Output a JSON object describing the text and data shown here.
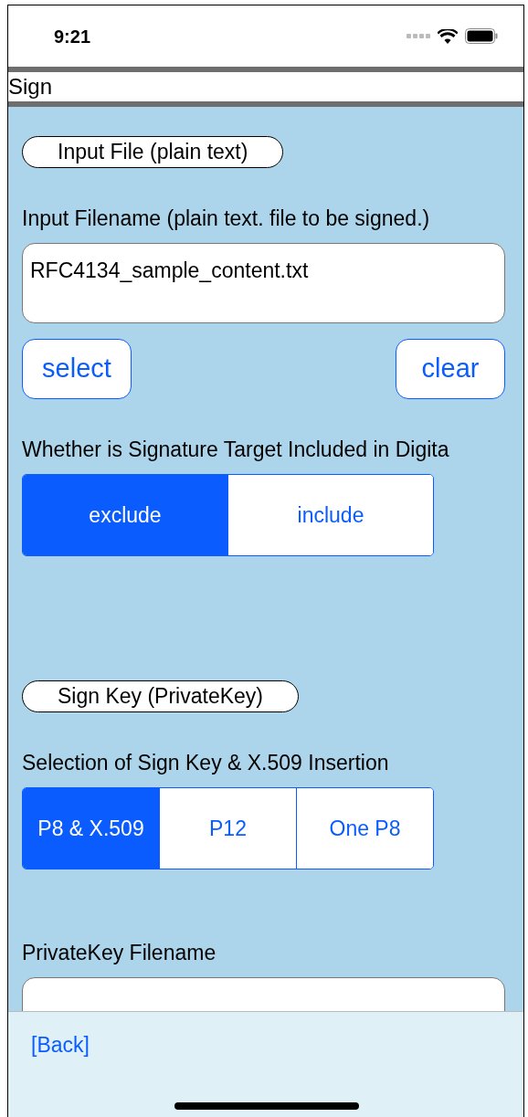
{
  "status_bar": {
    "time": "9:21"
  },
  "nav": {
    "title": "Sign"
  },
  "sections": [
    {
      "kind": "header",
      "label": "Input File (plain text)"
    },
    {
      "kind": "label",
      "text": "Input Filename (plain text. file to be signed.)"
    },
    {
      "kind": "field",
      "value": "RFC4134_sample_content.txt"
    },
    {
      "kind": "buttons",
      "buttons": [
        "select",
        "clear"
      ]
    },
    {
      "kind": "label",
      "text": "Whether is Signature Target Included in Digita"
    },
    {
      "kind": "segmented",
      "segments": [
        {
          "label": "exclude",
          "selected": true
        },
        {
          "label": "include",
          "selected": false
        }
      ]
    },
    {
      "kind": "spacer"
    },
    {
      "kind": "header",
      "label": "Sign Key (PrivateKey)"
    },
    {
      "kind": "label",
      "text": "Selection of Sign Key & X.509 Insertion"
    },
    {
      "kind": "segmented",
      "segments": [
        {
          "label": "P8 & X.509",
          "selected": true
        },
        {
          "label": "P12",
          "selected": false
        },
        {
          "label": "One P8",
          "selected": false
        }
      ]
    },
    {
      "kind": "gap"
    },
    {
      "kind": "label",
      "text": "PrivateKey Filename"
    },
    {
      "kind": "field"
    }
  ],
  "footer": {
    "back": "[Back]"
  }
}
